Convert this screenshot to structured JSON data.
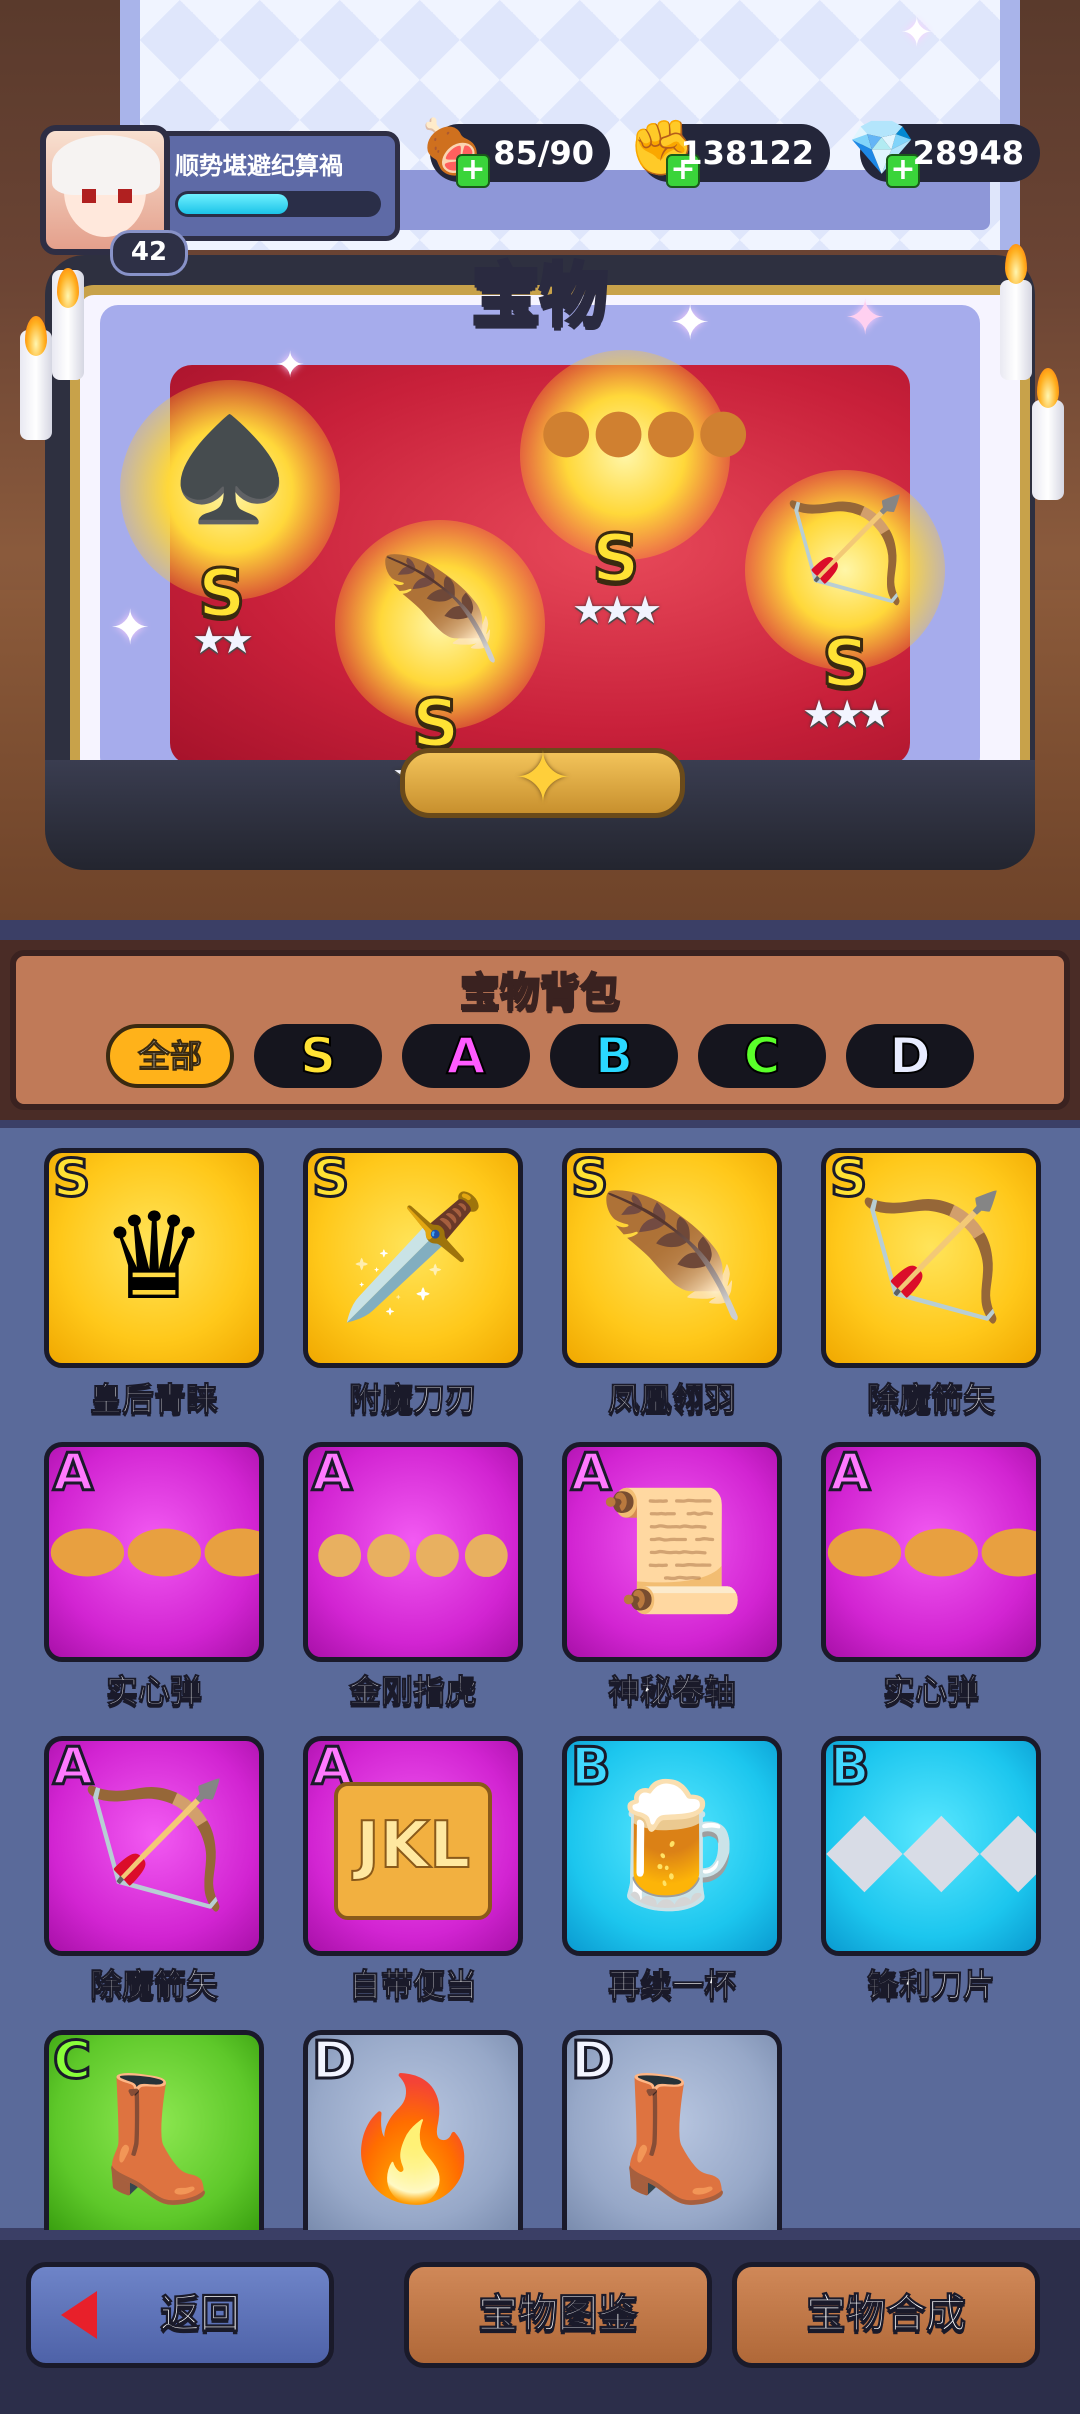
{
  "player": {
    "name": "顺势堪避纪算禍",
    "level": "42",
    "xp_fraction": 0.55
  },
  "resources": [
    {
      "name": "stamina",
      "icon": "meat-icon",
      "value": "85/90"
    },
    {
      "name": "silver",
      "icon": "fist-coin-icon",
      "value": "138122"
    },
    {
      "name": "gems",
      "icon": "diamond-icon",
      "value": "28948"
    }
  ],
  "page_title": "宝物",
  "displayed_treasures": [
    {
      "grade": "S",
      "stars": "★★",
      "icon": "casino-chip-icon"
    },
    {
      "grade": "S",
      "stars": "★★★",
      "icon": "phoenix-feather-icon"
    },
    {
      "grade": "S",
      "stars": "★★★",
      "icon": "brass-knuckles-icon"
    },
    {
      "grade": "S",
      "stars": "★★★",
      "icon": "bow-arrow-icon"
    }
  ],
  "bag": {
    "title": "宝物背包",
    "filters": [
      {
        "label": "全部",
        "active": true,
        "color": "#ffb21a"
      },
      {
        "label": "S",
        "color": "#ffe234"
      },
      {
        "label": "A",
        "color": "#ff5aff"
      },
      {
        "label": "B",
        "color": "#2ad8ff"
      },
      {
        "label": "C",
        "color": "#5aff2a"
      },
      {
        "label": "D",
        "color": "#e8ecff"
      }
    ],
    "items": [
      {
        "grade": "S",
        "name": "皇后青睐",
        "icon": "queen-chess-piece-icon"
      },
      {
        "grade": "S",
        "name": "附魔刀刃",
        "icon": "enchanted-blade-icon"
      },
      {
        "grade": "S",
        "name": "凤凰翎羽",
        "icon": "phoenix-feather-icon"
      },
      {
        "grade": "S",
        "name": "除魔箭矢",
        "icon": "bow-arrow-icon"
      },
      {
        "grade": "A",
        "name": "实心弹",
        "icon": "bullets-icon"
      },
      {
        "grade": "A",
        "name": "金刚指虎",
        "icon": "brass-knuckles-icon"
      },
      {
        "grade": "A",
        "name": "神秘卷轴",
        "icon": "scroll-icon"
      },
      {
        "grade": "A",
        "name": "实心弹",
        "icon": "bullets-icon"
      },
      {
        "grade": "A",
        "name": "除魔箭矢",
        "icon": "bow-arrow-icon"
      },
      {
        "grade": "A",
        "name": "自带便当",
        "icon": "lunch-bag-icon",
        "text_on_icon": "JKL"
      },
      {
        "grade": "B",
        "name": "再续一杯",
        "icon": "beer-mug-icon"
      },
      {
        "grade": "B",
        "name": "锋利刀片",
        "icon": "blades-icon"
      },
      {
        "grade": "C",
        "name": "",
        "icon": "lightning-boot-icon"
      },
      {
        "grade": "D",
        "name": "",
        "icon": "spiked-club-icon"
      },
      {
        "grade": "D",
        "name": "",
        "icon": "lightning-boot-icon"
      }
    ]
  },
  "buttons": {
    "back": "返回",
    "codex": "宝物图鉴",
    "synthesis": "宝物合成"
  }
}
